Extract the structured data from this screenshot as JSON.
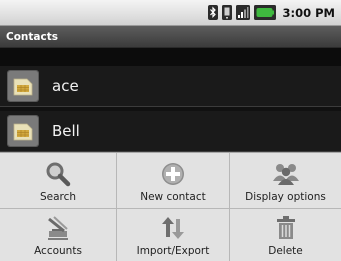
{
  "status_bar": {
    "time": "3:00 PM",
    "icons": [
      "bluetooth-icon",
      "vibrate-icon",
      "signal-icon",
      "battery-icon"
    ]
  },
  "title_bar": {
    "title": "Contacts"
  },
  "contacts": [
    {
      "name": "ace"
    },
    {
      "name": "Bell"
    }
  ],
  "menu": {
    "items": [
      {
        "label": "Search",
        "icon": "search-icon"
      },
      {
        "label": "New contact",
        "icon": "add-contact-icon"
      },
      {
        "label": "Display options",
        "icon": "people-icon"
      },
      {
        "label": "Accounts",
        "icon": "accounts-icon"
      },
      {
        "label": "Import/Export",
        "icon": "import-export-icon"
      },
      {
        "label": "Delete",
        "icon": "trash-icon"
      }
    ]
  },
  "colors": {
    "battery_green": "#3fb93f",
    "list_background": "#1a1a1a",
    "menu_background": "#e1e1e1"
  }
}
